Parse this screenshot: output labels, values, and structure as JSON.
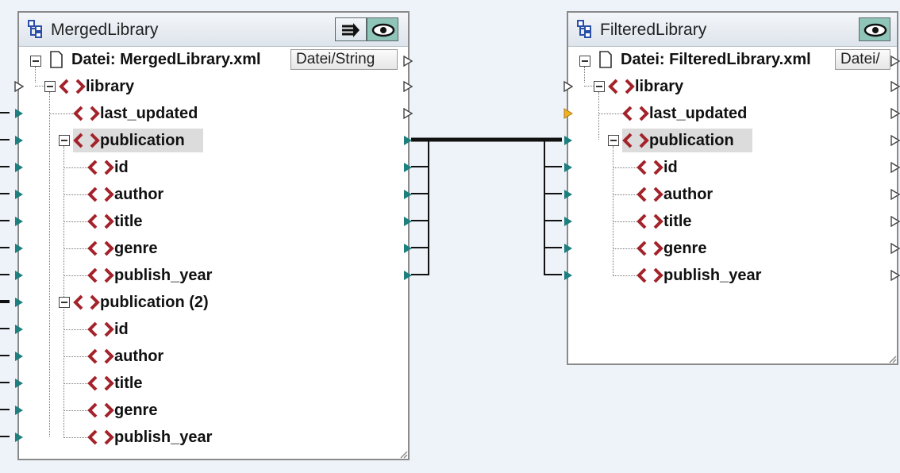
{
  "components": [
    {
      "title": "MergedLibrary",
      "file_label": "Datei: MergedLibrary.xml",
      "file_button": "Datei/String",
      "nodes": [
        "library",
        "last_updated",
        "publication",
        "id",
        "author",
        "title",
        "genre",
        "publish_year",
        "publication (2)",
        "id",
        "author",
        "title",
        "genre",
        "publish_year"
      ]
    },
    {
      "title": "FilteredLibrary",
      "file_label": "Datei: FilteredLibrary.xml",
      "file_button": "Datei/",
      "nodes": [
        "library",
        "last_updated",
        "publication",
        "id",
        "author",
        "title",
        "genre",
        "publish_year"
      ]
    }
  ],
  "colors": {
    "connected_port": "#1e7f7f",
    "filter_port": "#f0b020",
    "element_icon": "#a3232b",
    "link": "#111111",
    "canvas": "#eef3f9"
  },
  "icons": [
    "component-icon",
    "file-icon",
    "element-icon",
    "filter-toggle-icon",
    "eye-icon",
    "collapse-icon",
    "input-port",
    "output-port",
    "resize-grip-icon"
  ]
}
